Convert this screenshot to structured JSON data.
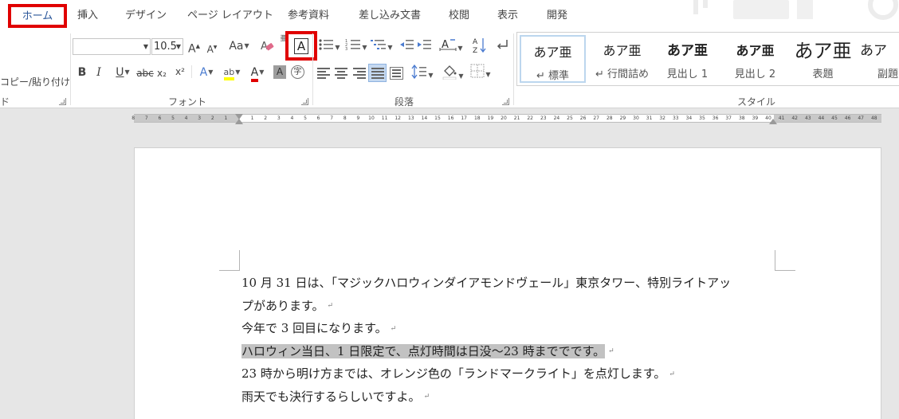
{
  "tabs": [
    {
      "id": "home",
      "label": "ホーム",
      "active": true
    },
    {
      "id": "insert",
      "label": "挿入"
    },
    {
      "id": "design",
      "label": "デザイン"
    },
    {
      "id": "layout",
      "label": "ページ レイアウト"
    },
    {
      "id": "references",
      "label": "参考資料"
    },
    {
      "id": "mailings",
      "label": "差し込み文書"
    },
    {
      "id": "review",
      "label": "校閲"
    },
    {
      "id": "view",
      "label": "表示"
    },
    {
      "id": "developer",
      "label": "開発"
    }
  ],
  "clipboard": {
    "copy_paste_label": "コピー/貼り付け",
    "group_label_fragment": "ド"
  },
  "font": {
    "group_label": "フォント",
    "font_name_value": "",
    "font_size_value": "10.5",
    "grow_label": "A",
    "shrink_label": "A",
    "case_label": "Aa",
    "clear_format_label": "A",
    "phonetic_label": "亜",
    "enclosed_char_label": "A",
    "bold_label": "B",
    "italic_label": "I",
    "underline_label": "U",
    "strike_label": "abc",
    "subscript_label": "x₂",
    "superscript_label": "x²",
    "effects_label": "A",
    "highlight_label": "ab",
    "font_color_label": "A",
    "shading_label": "A",
    "enclosed_ring_label": "字"
  },
  "paragraph": {
    "group_label": "段落",
    "sort_label": "A↓Z"
  },
  "styles": {
    "group_label": "スタイル",
    "items": [
      {
        "preview": "あア亜",
        "name": "↵ 標準",
        "selected": true
      },
      {
        "preview": "あア亜",
        "name": "↵ 行間詰め"
      },
      {
        "preview": "あア亜",
        "name": "見出し 1"
      },
      {
        "preview": "あア亜",
        "name": "見出し 2"
      },
      {
        "preview": "あア亜",
        "name": "表題"
      },
      {
        "preview": "あア",
        "name": "副題"
      }
    ]
  },
  "ruler": {
    "left_numbers": [
      "8",
      "7",
      "6",
      "5",
      "4",
      "3",
      "2",
      "1"
    ],
    "right_numbers": [
      "1",
      "2",
      "3",
      "4",
      "5",
      "6",
      "7",
      "8",
      "9",
      "10",
      "11",
      "12",
      "13",
      "14",
      "15",
      "16",
      "17",
      "18",
      "19",
      "20",
      "21",
      "22",
      "23",
      "24",
      "25",
      "26",
      "27",
      "28",
      "29",
      "30",
      "31",
      "32",
      "33",
      "34",
      "35",
      "36",
      "37",
      "38",
      "39",
      "40",
      "41",
      "42",
      "43",
      "44",
      "45",
      "46",
      "47",
      "48"
    ]
  },
  "document": {
    "paragraphs": [
      {
        "text": "10 月 31 日は、「マジックハロウィンダイアモンドヴェール」東京タワー、特別ライトアッ",
        "mark": ""
      },
      {
        "text": "プがあります。",
        "mark": "↵"
      },
      {
        "text": "今年で 3 回目になります。",
        "mark": "↵"
      },
      {
        "text": "ハロウィン当日、1 日限定で、点灯時間は日没～23 時まででです。",
        "mark": "↵",
        "highlighted": true
      },
      {
        "text": "23 時から明け方までは、オレンジ色の「ランドマークライト」を点灯します。",
        "mark": "↵"
      },
      {
        "text": "雨天でも決行するらしいですよ。",
        "mark": "↵"
      }
    ]
  },
  "colors": {
    "accent": "#2b579a",
    "callout": "#e00000",
    "highlight_yellow": "#ffff00",
    "font_color_red": "#e00000"
  }
}
